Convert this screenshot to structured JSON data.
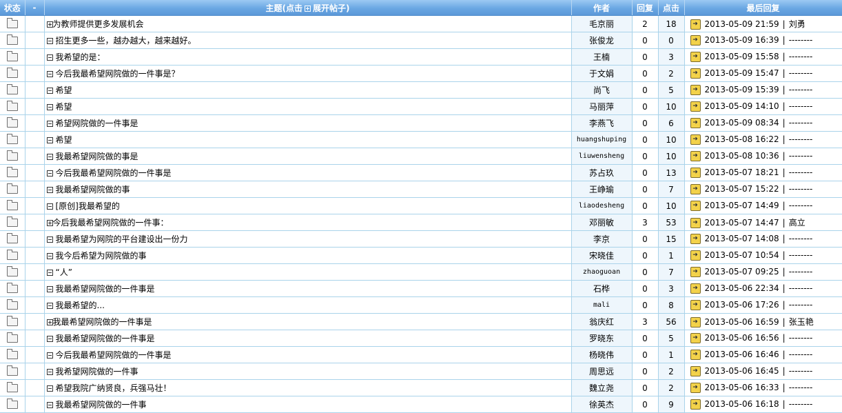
{
  "header": {
    "status": "状态",
    "dash": "-",
    "title_prefix": "主题(点击",
    "title_suffix": "展开帖子)",
    "author": "作者",
    "replies": "回复",
    "clicks": "点击",
    "last_reply": "最后回复"
  },
  "separator": "|",
  "rows": [
    {
      "expanded": true,
      "title": "为教师提供更多发展机会",
      "author": "毛京丽",
      "replies": "2",
      "clicks": "18",
      "time": "2013-05-09 21:59",
      "last_user": "刘勇"
    },
    {
      "expanded": false,
      "title": "招生更多一些，越办越大，越来越好。",
      "author": "张俊龙",
      "replies": "0",
      "clicks": "0",
      "time": "2013-05-09 16:39",
      "last_user": "--------"
    },
    {
      "expanded": false,
      "title": "我希望的是：",
      "author": "王楠",
      "replies": "0",
      "clicks": "3",
      "time": "2013-05-09 15:58",
      "last_user": "--------"
    },
    {
      "expanded": false,
      "title": "今后我最希望网院做的一件事是？",
      "author": "于文娟",
      "replies": "0",
      "clicks": "2",
      "time": "2013-05-09 15:47",
      "last_user": "--------"
    },
    {
      "expanded": false,
      "title": "希望",
      "author": "尚飞",
      "replies": "0",
      "clicks": "5",
      "time": "2013-05-09 15:39",
      "last_user": "--------"
    },
    {
      "expanded": false,
      "title": "希望",
      "author": "马丽萍",
      "replies": "0",
      "clicks": "10",
      "time": "2013-05-09 14:10",
      "last_user": "--------"
    },
    {
      "expanded": false,
      "title": "希望网院做的一件事是",
      "author": "李燕飞",
      "replies": "0",
      "clicks": "6",
      "time": "2013-05-09 08:34",
      "last_user": "--------"
    },
    {
      "expanded": false,
      "title": "希望",
      "author": "huangshuping",
      "replies": "0",
      "clicks": "10",
      "time": "2013-05-08 16:22",
      "last_user": "--------"
    },
    {
      "expanded": false,
      "title": "我最希望网院做的事是",
      "author": "liuwensheng",
      "replies": "0",
      "clicks": "10",
      "time": "2013-05-08 10:36",
      "last_user": "--------"
    },
    {
      "expanded": false,
      "title": "今后我最希望网院做的一件事是",
      "author": "苏占玖",
      "replies": "0",
      "clicks": "13",
      "time": "2013-05-07 18:21",
      "last_user": "--------"
    },
    {
      "expanded": false,
      "title": "我最希望网院做的事",
      "author": "王峥瑜",
      "replies": "0",
      "clicks": "7",
      "time": "2013-05-07 15:22",
      "last_user": "--------"
    },
    {
      "expanded": false,
      "title": "[原创]我最希望的",
      "author": "liaodesheng",
      "replies": "0",
      "clicks": "10",
      "time": "2013-05-07 14:49",
      "last_user": "--------"
    },
    {
      "expanded": true,
      "title": "今后我最希望网院做的一件事：",
      "author": "邓丽敏",
      "replies": "3",
      "clicks": "53",
      "time": "2013-05-07 14:47",
      "last_user": "高立"
    },
    {
      "expanded": false,
      "title": "我最希望为网院的平台建设出一份力",
      "author": "李京",
      "replies": "0",
      "clicks": "15",
      "time": "2013-05-07 14:08",
      "last_user": "--------"
    },
    {
      "expanded": false,
      "title": "我今后希望为网院做的事",
      "author": "宋晓佳",
      "replies": "0",
      "clicks": "1",
      "time": "2013-05-07 10:54",
      "last_user": "--------"
    },
    {
      "expanded": false,
      "title": "“人”",
      "author": "zhaoguoan",
      "replies": "0",
      "clicks": "7",
      "time": "2013-05-07 09:25",
      "last_user": "--------"
    },
    {
      "expanded": false,
      "title": "我最希望网院做的一件事是",
      "author": "石桦",
      "replies": "0",
      "clicks": "3",
      "time": "2013-05-06 22:34",
      "last_user": "--------"
    },
    {
      "expanded": false,
      "title": "我最希望的...",
      "author": "mali",
      "replies": "0",
      "clicks": "8",
      "time": "2013-05-06 17:26",
      "last_user": "--------"
    },
    {
      "expanded": true,
      "title": "我最希望网院做的一件事是",
      "author": "翁庆红",
      "replies": "3",
      "clicks": "56",
      "time": "2013-05-06 16:59",
      "last_user": "张玉艳"
    },
    {
      "expanded": false,
      "title": "我最希望网院做的一件事是",
      "author": "罗晓东",
      "replies": "0",
      "clicks": "5",
      "time": "2013-05-06 16:56",
      "last_user": "--------"
    },
    {
      "expanded": false,
      "title": "今后我最希望网院做的一件事是",
      "author": "杨晓伟",
      "replies": "0",
      "clicks": "1",
      "time": "2013-05-06 16:46",
      "last_user": "--------"
    },
    {
      "expanded": false,
      "title": "我希望网院做的一件事",
      "author": "周思远",
      "replies": "0",
      "clicks": "2",
      "time": "2013-05-06 16:45",
      "last_user": "--------"
    },
    {
      "expanded": false,
      "title": "希望我院广纳贤良，兵强马壮！",
      "author": "魏立尧",
      "replies": "0",
      "clicks": "2",
      "time": "2013-05-06 16:33",
      "last_user": "--------"
    },
    {
      "expanded": false,
      "title": "我最希望网院做的一件事",
      "author": "徐英杰",
      "replies": "0",
      "clicks": "9",
      "time": "2013-05-06 16:18",
      "last_user": "--------"
    }
  ]
}
